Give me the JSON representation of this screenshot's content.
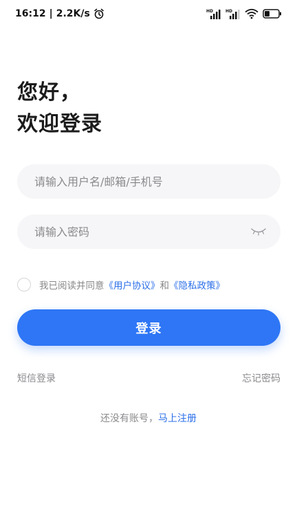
{
  "status_bar": {
    "time": "16:12",
    "separator": "|",
    "speed": "2.2K/s",
    "icons": [
      "alarm-icon",
      "signal-hd-icon",
      "signal-hd-icon",
      "wifi-icon",
      "battery-icon"
    ]
  },
  "greeting": {
    "line1": "您好，",
    "line2": "欢迎登录"
  },
  "form": {
    "username_placeholder": "请输入用户名/邮箱/手机号",
    "username_value": "",
    "password_placeholder": "请输入密码",
    "password_value": ""
  },
  "agreement": {
    "prefix": "我已阅读并同意",
    "user_agreement": "《用户协议》",
    "and": "和",
    "privacy_policy": "《隐私政策》",
    "checked": false
  },
  "login_button": "登录",
  "links": {
    "sms_login": "短信登录",
    "forgot_password": "忘记密码"
  },
  "register": {
    "prompt": "还没有账号，",
    "link": "马上注册"
  },
  "colors": {
    "accent": "#2e76f5",
    "link": "#2b6fe8",
    "input_bg": "#f6f6f8",
    "muted_text": "#8a8a8e"
  }
}
